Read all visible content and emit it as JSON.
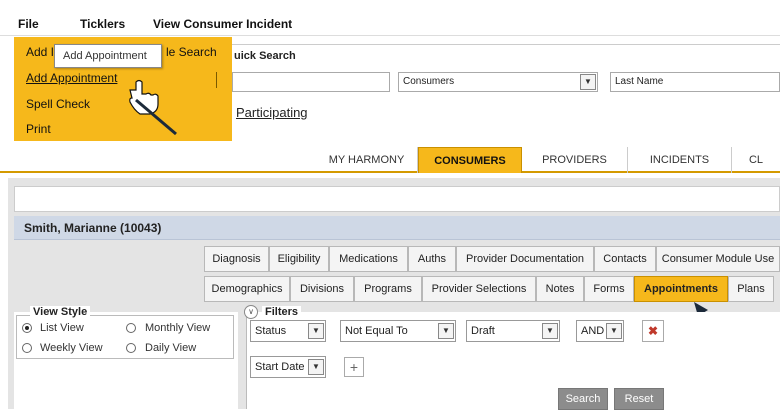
{
  "menubar": {
    "items": [
      "File",
      "Ticklers",
      "View Consumer Incident"
    ]
  },
  "file_menu": {
    "hidden_first_item": "Add I",
    "partial_search_text": "le Search",
    "items": [
      "Add Appointment",
      "Spell Check",
      "Print"
    ],
    "tooltip": "Add Appointment"
  },
  "quick_search": {
    "legend": "uick Search",
    "type_select": "Consumers",
    "field_select": "Last Name",
    "participating_link": "Participating"
  },
  "main_tabs": {
    "items": [
      "MY HARMONY",
      "CONSUMERS",
      "PROVIDERS",
      "INCIDENTS",
      "CL"
    ],
    "active": "CONSUMERS"
  },
  "consumer": {
    "name": "Smith, Marianne (10043)"
  },
  "sub_tabs": {
    "row1": [
      "Diagnosis",
      "Eligibility",
      "Medications",
      "Auths",
      "Provider Documentation",
      "Contacts",
      "Consumer Module Use"
    ],
    "row2": [
      "Demographics",
      "Divisions",
      "Programs",
      "Provider Selections",
      "Notes",
      "Forms",
      "Appointments",
      "Plans"
    ],
    "active": "Appointments"
  },
  "view_style": {
    "legend": "View Style",
    "options": [
      "List View",
      "Monthly View",
      "Weekly View",
      "Daily View"
    ],
    "selected": "List View"
  },
  "filters": {
    "legend": "Filters",
    "row1": {
      "field": "Status",
      "operator": "Not Equal To",
      "value": "Draft",
      "join": "AND"
    },
    "row2": {
      "field": "Start Date"
    },
    "search_label": "Search",
    "reset_label": "Reset"
  },
  "colors": {
    "accent": "#f6b81b",
    "name_bar": "#cfd8e6"
  }
}
